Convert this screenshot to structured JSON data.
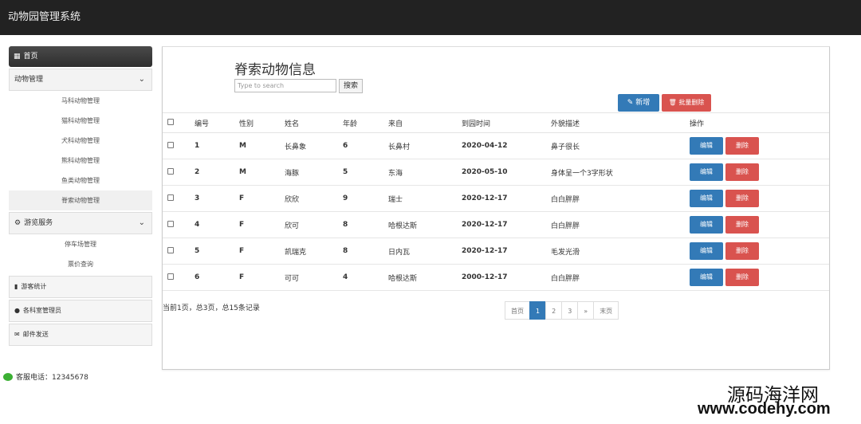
{
  "app": {
    "title": "动物园管理系统"
  },
  "sidebar": {
    "home": "首页",
    "groups": [
      {
        "label": "动物管理",
        "items": [
          "马科动物管理",
          "猫科动物管理",
          "犬科动物管理",
          "熊科动物管理",
          "鱼类动物管理",
          "脊索动物管理"
        ]
      },
      {
        "label": "游览服务",
        "items": [
          "停车场管理",
          "票价查询"
        ]
      }
    ],
    "blocks": [
      "游客统计",
      "各科室管理员",
      "邮件发送"
    ],
    "selected_item": "脊索动物管理"
  },
  "footer": {
    "phone": "客服电话：12345678"
  },
  "panel": {
    "title": "脊索动物信息",
    "search_placeholder": "Type to search",
    "search_button": "搜索",
    "new_button": "新增",
    "bulk_delete_button": "批量删除"
  },
  "table": {
    "headers": [
      "编号",
      "性别",
      "姓名",
      "年龄",
      "来自",
      "到园时间",
      "外貌描述",
      "操作"
    ],
    "rows": [
      [
        "1",
        "M",
        "长鼻象",
        "6",
        "长鼻村",
        "2020-04-12",
        "鼻子很长"
      ],
      [
        "2",
        "M",
        "海豚",
        "5",
        "东海",
        "2020-05-10",
        "身体呈一个3字形状"
      ],
      [
        "3",
        "F",
        "欣欣",
        "9",
        "瑞士",
        "2020-12-17",
        "白白胖胖"
      ],
      [
        "4",
        "F",
        "欣可",
        "8",
        "哈根达斯",
        "2020-12-17",
        "白白胖胖"
      ],
      [
        "5",
        "F",
        "凯瑞克",
        "8",
        "日内瓦",
        "2020-12-17",
        "毛发光滑"
      ],
      [
        "6",
        "F",
        "可可",
        "4",
        "哈根达斯",
        "2000-12-17",
        "白白胖胖"
      ]
    ],
    "edit_label": "编辑",
    "delete_label": "删除"
  },
  "pagination": {
    "info": "当前1页，总3页，总15条记录",
    "first": "首页",
    "pages": [
      "1",
      "2",
      "3"
    ],
    "next": "»",
    "last": "末页",
    "current": "1"
  },
  "watermark": {
    "line1": "源码海洋网",
    "line2": "www.codehy.com"
  }
}
